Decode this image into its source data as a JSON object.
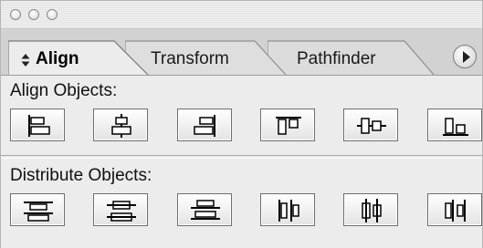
{
  "window": {
    "controls": [
      "close-button",
      "minimize-button",
      "zoom-button"
    ]
  },
  "tabs": [
    {
      "label": "Align",
      "active": true,
      "prefix_icon": "updown-arrows-icon"
    },
    {
      "label": "Transform",
      "active": false
    },
    {
      "label": "Pathfinder",
      "active": false
    }
  ],
  "tab_scroll": {
    "icon": "chevron-right-icon"
  },
  "align_section": {
    "title": "Align Objects:",
    "buttons": [
      {
        "name": "horizontal-align-left",
        "icon": "align-left-icon"
      },
      {
        "name": "horizontal-align-center",
        "icon": "align-horizontal-center-icon"
      },
      {
        "name": "horizontal-align-right",
        "icon": "align-right-icon"
      },
      {
        "name": "vertical-align-top",
        "icon": "align-top-icon"
      },
      {
        "name": "vertical-align-center",
        "icon": "align-vertical-center-icon"
      },
      {
        "name": "vertical-align-bottom",
        "icon": "align-bottom-icon"
      }
    ]
  },
  "distribute_section": {
    "title": "Distribute Objects:",
    "buttons": [
      {
        "name": "vertical-distribute-top",
        "icon": "distribute-top-icon"
      },
      {
        "name": "vertical-distribute-center",
        "icon": "distribute-vertical-center-icon"
      },
      {
        "name": "vertical-distribute-bottom",
        "icon": "distribute-bottom-icon"
      },
      {
        "name": "horizontal-distribute-left",
        "icon": "distribute-left-icon"
      },
      {
        "name": "horizontal-distribute-center",
        "icon": "distribute-horizontal-center-icon"
      },
      {
        "name": "horizontal-distribute-right",
        "icon": "distribute-right-icon"
      }
    ]
  }
}
